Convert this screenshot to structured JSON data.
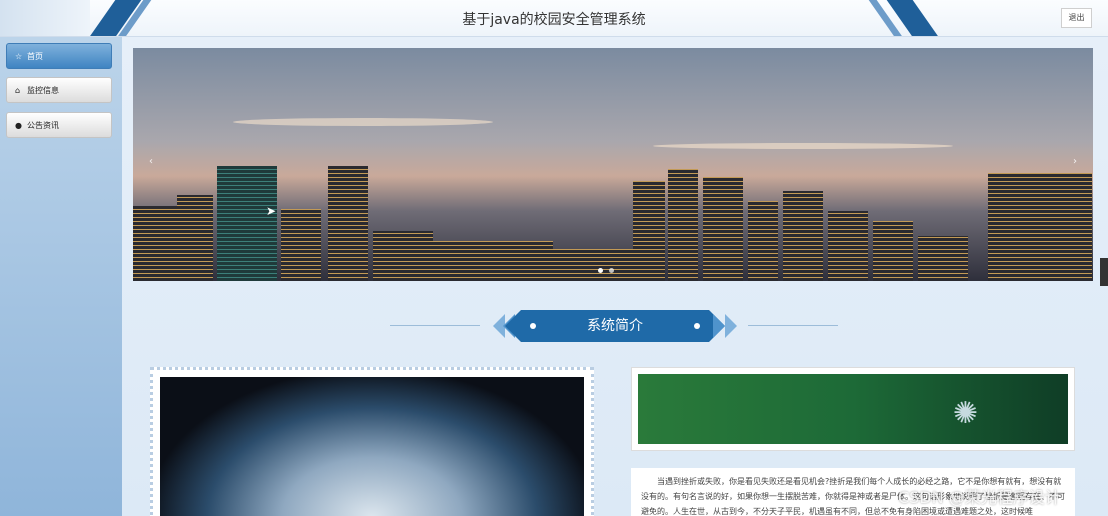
{
  "header": {
    "title": "基于java的校园安全管理系统",
    "logout_label": "退出"
  },
  "sidebar": {
    "items": [
      {
        "label": "首页",
        "icon": "star-icon",
        "active": true
      },
      {
        "label": "监控信息",
        "icon": "home-icon",
        "active": false
      },
      {
        "label": "公告资讯",
        "icon": "info-icon",
        "active": false
      }
    ]
  },
  "carousel": {
    "slides": 2,
    "active_index": 0
  },
  "section": {
    "title": "系统简介"
  },
  "intro": {
    "text": "当遇到挫折或失败，你是看见失败还是看见机会?挫折是我们每个人成长的必经之路，它不是你想有就有，想没有就没有的。有句名言说的好，如果你想一生摆脱苦难，你就得是神或者是尸体。这句话形象地说明了挫折是客观存在、不可避免的。人生在世，从古到今，不分天子平民，机遇虽有不同，但总不免有身陷困境或遭遇难题之处，这时候唯"
  },
  "watermark": "CSDN @荣光程序设计",
  "colors": {
    "accent": "#3f84c2",
    "banner": "#1f5f99"
  }
}
